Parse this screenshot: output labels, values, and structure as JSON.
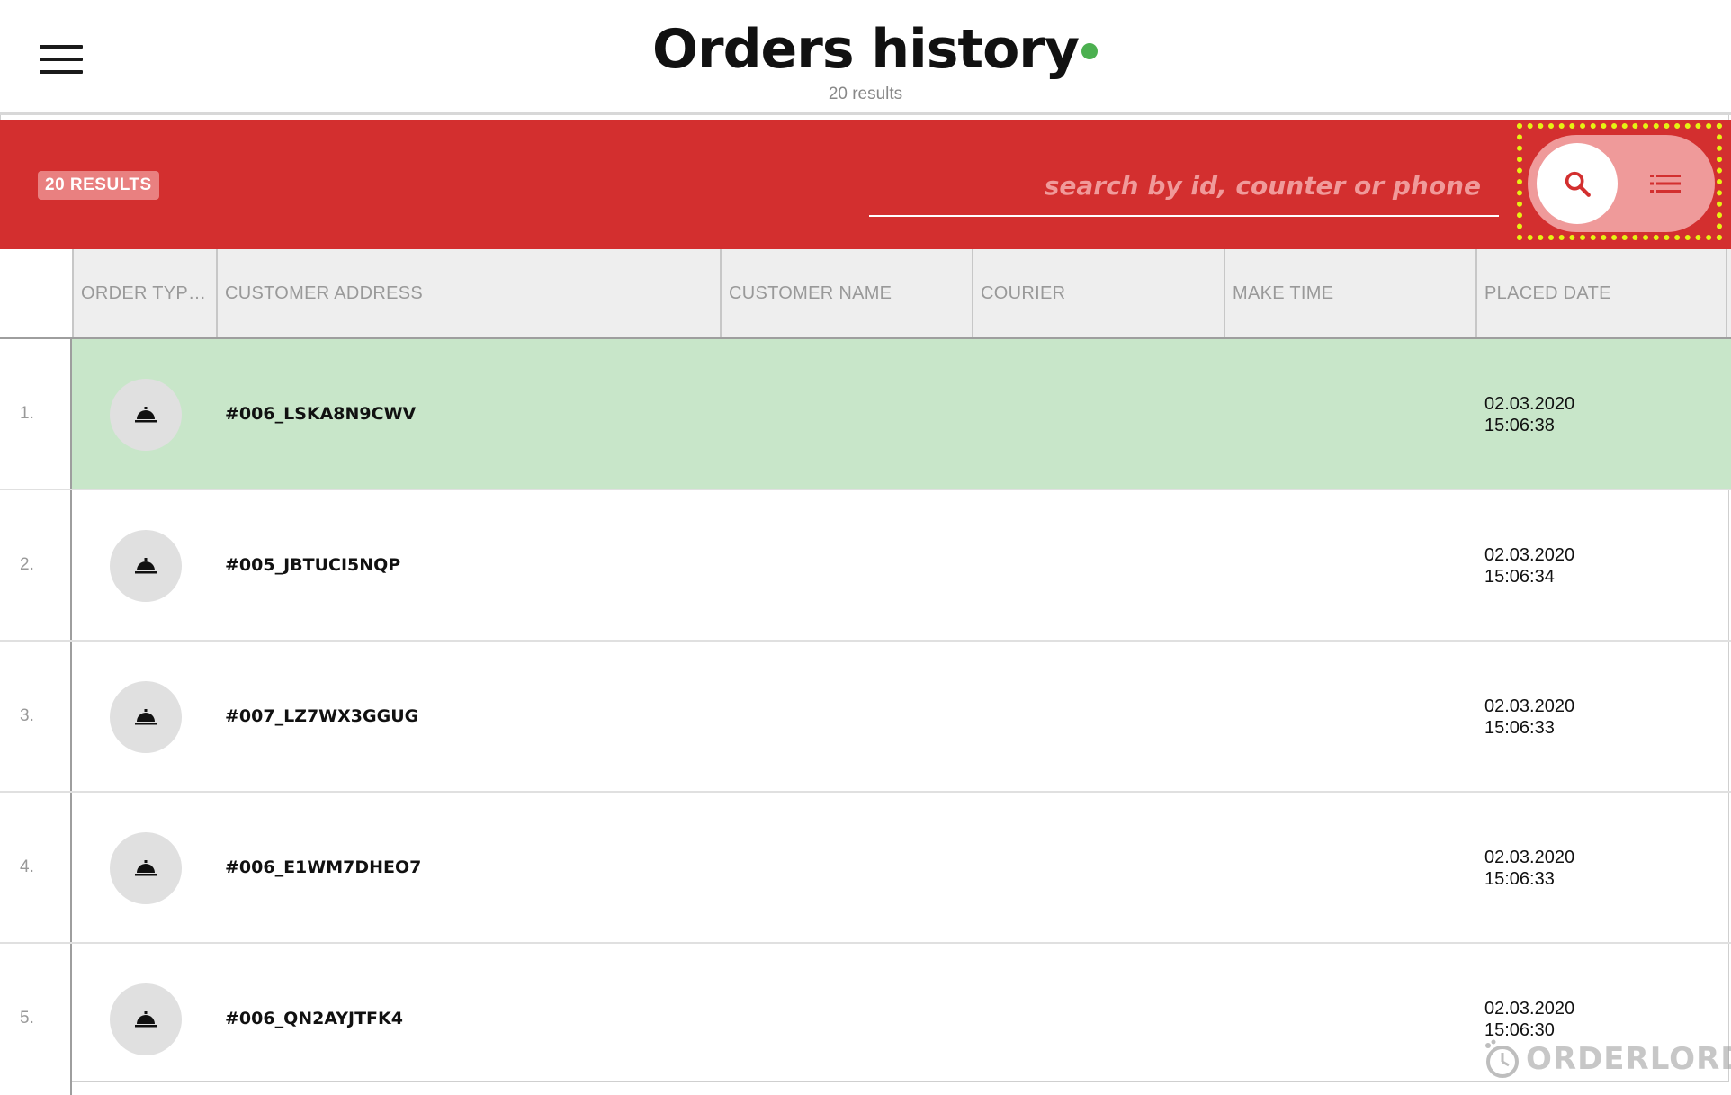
{
  "header": {
    "title": "Orders history",
    "subtitle": "20 results",
    "status_color": "#4cb050"
  },
  "toolbar": {
    "results_badge": "20 RESULTS",
    "search_placeholder": "search by id, counter or phone",
    "search_value": "",
    "view_toggle": {
      "active": "search",
      "options": [
        "search-icon",
        "list-icon"
      ]
    },
    "background_color": "#d32f2f"
  },
  "table": {
    "columns": [
      "ORDER TYPE...",
      "CUSTOMER ADDRESS",
      "CUSTOMER NAME",
      "COURIER",
      "MAKE TIME",
      "PLACED DATE"
    ],
    "rows": [
      {
        "num": "1.",
        "type_icon": "cloche-icon",
        "order_id": "#006_LSKA8N9CWV",
        "customer_name": "",
        "courier": "",
        "make_time": "",
        "placed_date": "02.03.2020",
        "placed_time": "15:06:38",
        "highlighted": true
      },
      {
        "num": "2.",
        "type_icon": "cloche-icon",
        "order_id": "#005_JBTUCI5NQP",
        "customer_name": "",
        "courier": "",
        "make_time": "",
        "placed_date": "02.03.2020",
        "placed_time": "15:06:34",
        "highlighted": false
      },
      {
        "num": "3.",
        "type_icon": "cloche-icon",
        "order_id": "#007_LZ7WX3GGUG",
        "customer_name": "",
        "courier": "",
        "make_time": "",
        "placed_date": "02.03.2020",
        "placed_time": "15:06:33",
        "highlighted": false
      },
      {
        "num": "4.",
        "type_icon": "cloche-icon",
        "order_id": "#006_E1WM7DHEO7",
        "customer_name": "",
        "courier": "",
        "make_time": "",
        "placed_date": "02.03.2020",
        "placed_time": "15:06:33",
        "highlighted": false
      },
      {
        "num": "5.",
        "type_icon": "cloche-icon",
        "order_id": "#006_QN2AYJTFK4",
        "customer_name": "",
        "courier": "",
        "make_time": "",
        "placed_date": "02.03.2020",
        "placed_time": "15:06:30",
        "highlighted": false
      }
    ]
  },
  "watermark": {
    "text": "ORDERLORD"
  }
}
